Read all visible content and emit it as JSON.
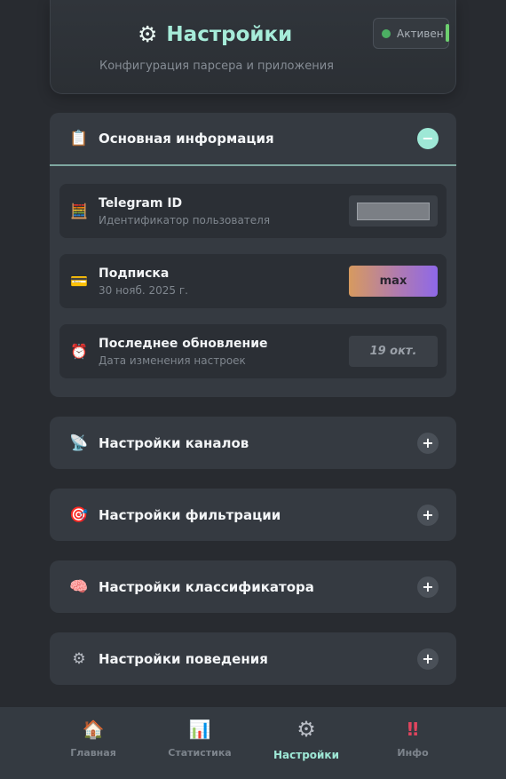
{
  "header": {
    "title": "Настройки",
    "subtitle": "Конфигурация парсера и приложения",
    "status": "Активен",
    "title_icon": "gear-icon"
  },
  "sections": [
    {
      "title": "Основная информация",
      "icon": "clipboard-icon",
      "expanded": true,
      "toggle": "−",
      "rows": [
        {
          "label": "Telegram ID",
          "sub": "Идентификатор пользователя",
          "icon": "calculator-icon",
          "value": ""
        },
        {
          "label": "Подписка",
          "sub": "30 нояб. 2025 г.",
          "icon": "credit-card-icon",
          "value": "max"
        },
        {
          "label": "Последнее обновление",
          "sub": "Дата изменения настроек",
          "icon": "alarm-clock-icon",
          "value": "19 окт."
        }
      ]
    },
    {
      "title": "Настройки каналов",
      "icon": "satellite-icon",
      "expanded": false,
      "toggle": "+"
    },
    {
      "title": "Настройки фильтрации",
      "icon": "target-icon",
      "expanded": false,
      "toggle": "+"
    },
    {
      "title": "Настройки классификатора",
      "icon": "brain-icon",
      "expanded": false,
      "toggle": "+"
    },
    {
      "title": "Настройки поведения",
      "icon": "gear-icon",
      "expanded": false,
      "toggle": "+"
    }
  ],
  "nav": [
    {
      "label": "Главная",
      "icon": "house-icon",
      "active": false
    },
    {
      "label": "Статистика",
      "icon": "bar-chart-icon",
      "active": false
    },
    {
      "label": "Настройки",
      "icon": "gear-icon",
      "active": true
    },
    {
      "label": "Инфо",
      "icon": "exclamation-icon",
      "active": false
    }
  ],
  "colors": {
    "background": "#282b30",
    "accent": "#9ee8d6",
    "status_green": "#4caf63",
    "card": "#353a41"
  }
}
